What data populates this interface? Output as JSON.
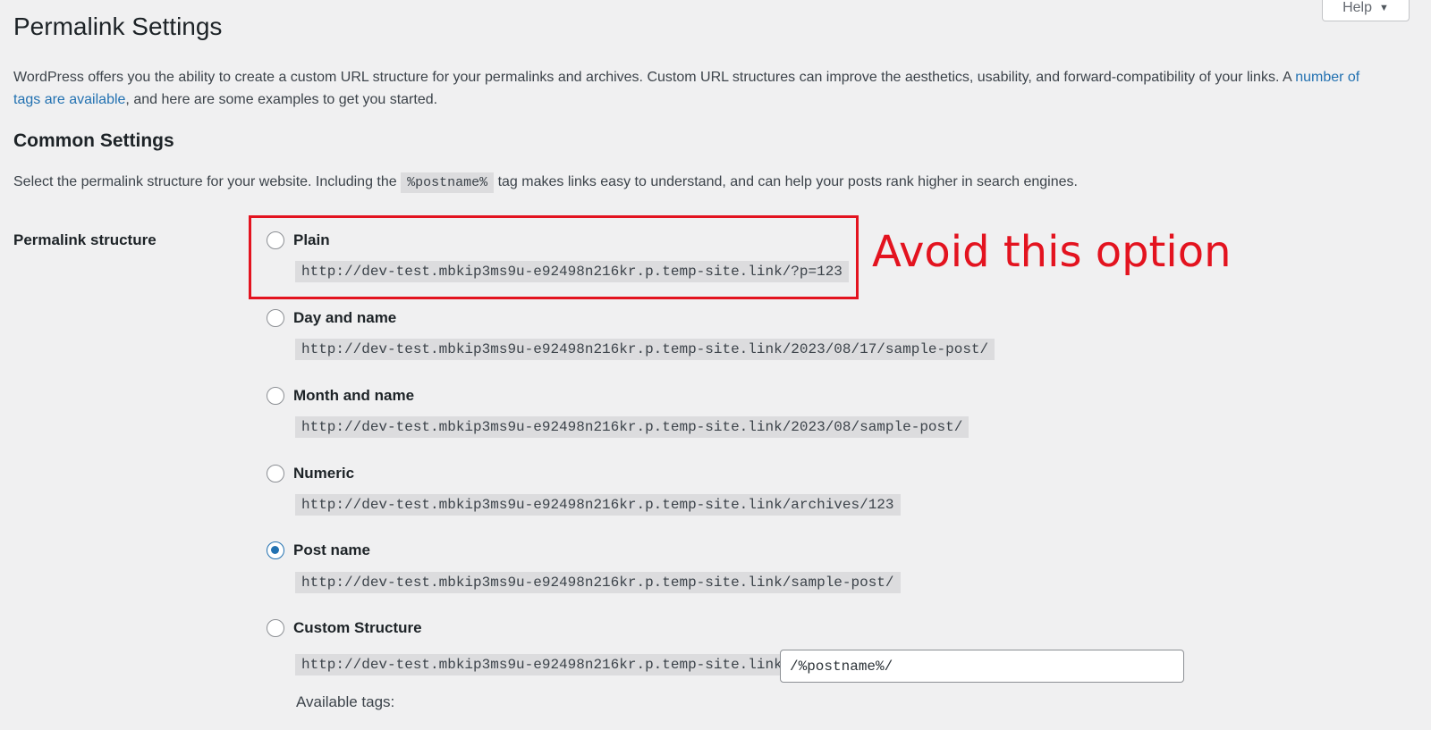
{
  "help": {
    "label": "Help",
    "caret": "▼"
  },
  "page_title": "Permalink Settings",
  "intro": {
    "text_before": "WordPress offers you the ability to create a custom URL structure for your permalinks and archives. Custom URL structures can improve the aesthetics, usability, and forward-compatibility of your links. A ",
    "link_text": "number of tags are available",
    "text_after": ", and here are some examples to get you started."
  },
  "common_settings": {
    "title": "Common Settings",
    "desc_before": "Select the permalink structure for your website. Including the ",
    "desc_code": "%postname%",
    "desc_after": " tag makes links easy to understand, and can help your posts rank higher in search engines."
  },
  "permalink_structure": {
    "label": "Permalink structure",
    "options": [
      {
        "label": "Plain",
        "example": "http://dev-test.mbkip3ms9u-e92498n216kr.p.temp-site.link/?p=123",
        "checked": false
      },
      {
        "label": "Day and name",
        "example": "http://dev-test.mbkip3ms9u-e92498n216kr.p.temp-site.link/2023/08/17/sample-post/",
        "checked": false
      },
      {
        "label": "Month and name",
        "example": "http://dev-test.mbkip3ms9u-e92498n216kr.p.temp-site.link/2023/08/sample-post/",
        "checked": false
      },
      {
        "label": "Numeric",
        "example": "http://dev-test.mbkip3ms9u-e92498n216kr.p.temp-site.link/archives/123",
        "checked": false
      },
      {
        "label": "Post name",
        "example": "http://dev-test.mbkip3ms9u-e92498n216kr.p.temp-site.link/sample-post/",
        "checked": true
      },
      {
        "label": "Custom Structure",
        "example": "http://dev-test.mbkip3ms9u-e92498n216kr.p.temp-site.link",
        "checked": false
      }
    ],
    "custom_value": "/%postname%/",
    "available_tags": "Available tags:"
  },
  "annotation": {
    "text": "Avoid this option",
    "color": "#e3131f"
  },
  "colors": {
    "accent": "#2271b1",
    "background": "#f0f0f1"
  }
}
